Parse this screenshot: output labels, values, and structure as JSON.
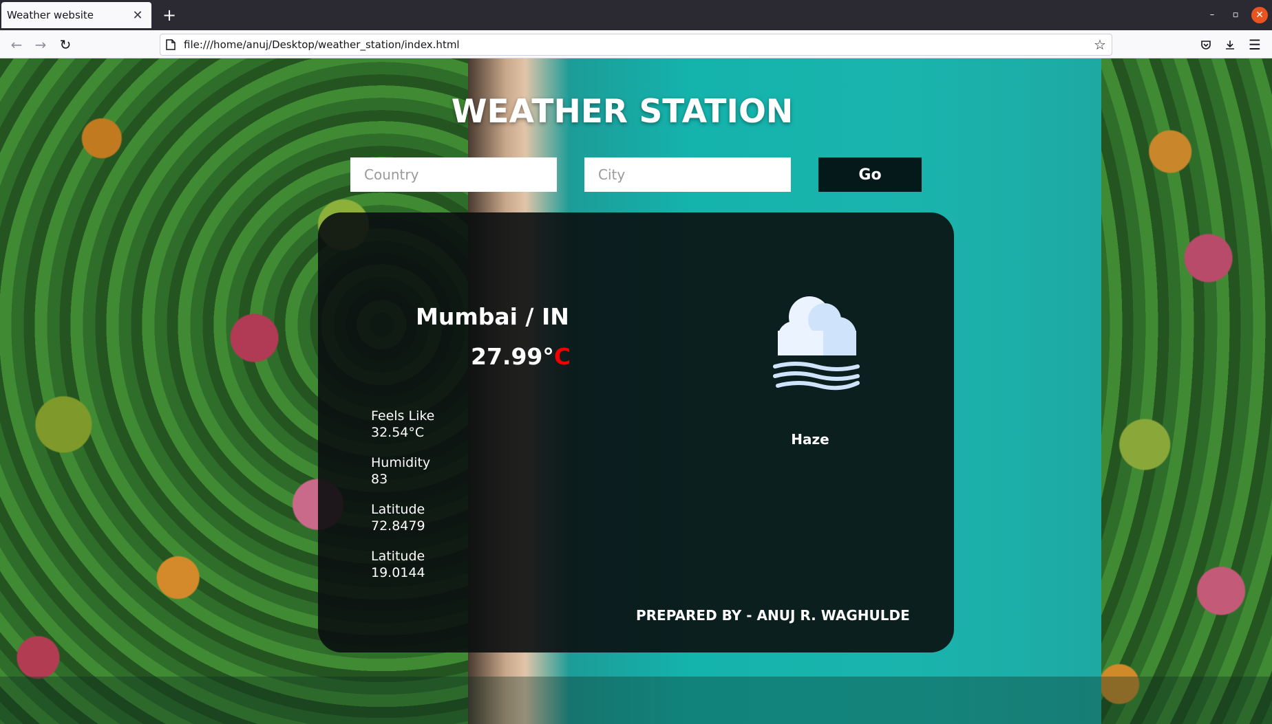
{
  "browser": {
    "tab_title": "Weather website",
    "url": "file:///home/anuj/Desktop/weather_station/index.html"
  },
  "page": {
    "title": "WEATHER STATION",
    "country_placeholder": "Country",
    "city_placeholder": "City",
    "go_label": "Go"
  },
  "weather": {
    "location": "Mumbai / IN",
    "temperature": "27.99°",
    "temperature_unit": "C",
    "condition": "Haze",
    "condition_icon": "haze-cloud-icon",
    "stats": [
      {
        "label": "Feels Like",
        "value": "32.54°C"
      },
      {
        "label": "Humidity",
        "value": "83"
      },
      {
        "label": "Latitude",
        "value": "72.8479"
      },
      {
        "label": "Latitude",
        "value": "19.0144"
      }
    ]
  },
  "footer": {
    "credit": "PREPARED BY - ANUJ R. WAGHULDE"
  },
  "colors": {
    "unit_accent": "#f20000",
    "button_bg": "#06191a",
    "card_bg": "#0a0e0f"
  }
}
